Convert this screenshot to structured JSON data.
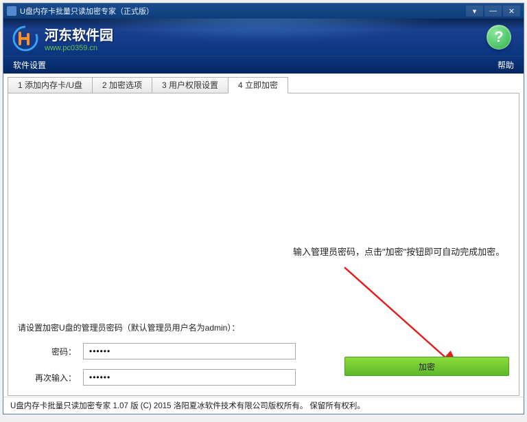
{
  "titlebar": {
    "title": "U盘内存卡批量只读加密专家（正式版）"
  },
  "header": {
    "logo_title": "河东软件园",
    "logo_url": "www.pc0359.cn"
  },
  "menubar": {
    "left": "软件设置",
    "right": "帮助"
  },
  "tabs": [
    {
      "label": "1 添加内存卡/U盘"
    },
    {
      "label": "2 加密选项"
    },
    {
      "label": "3 用户权限设置"
    },
    {
      "label": "4 立即加密"
    }
  ],
  "annotation": {
    "text": "输入管理员密码，点击\"加密\"按钮即可自动完成加密。"
  },
  "form": {
    "title": "请设置加密U盘的管理员密码（默认管理员用户名为admin）：",
    "password_label": "密码：",
    "password_value": "••••••",
    "confirm_label": "再次输入：",
    "confirm_value": "••••••",
    "encrypt_button": "加密"
  },
  "statusbar": {
    "text": "U盘内存卡批量只读加密专家 1.07 版  (C)  2015 洛阳夏冰软件技术有限公司版权所有。  保留所有权利。"
  }
}
